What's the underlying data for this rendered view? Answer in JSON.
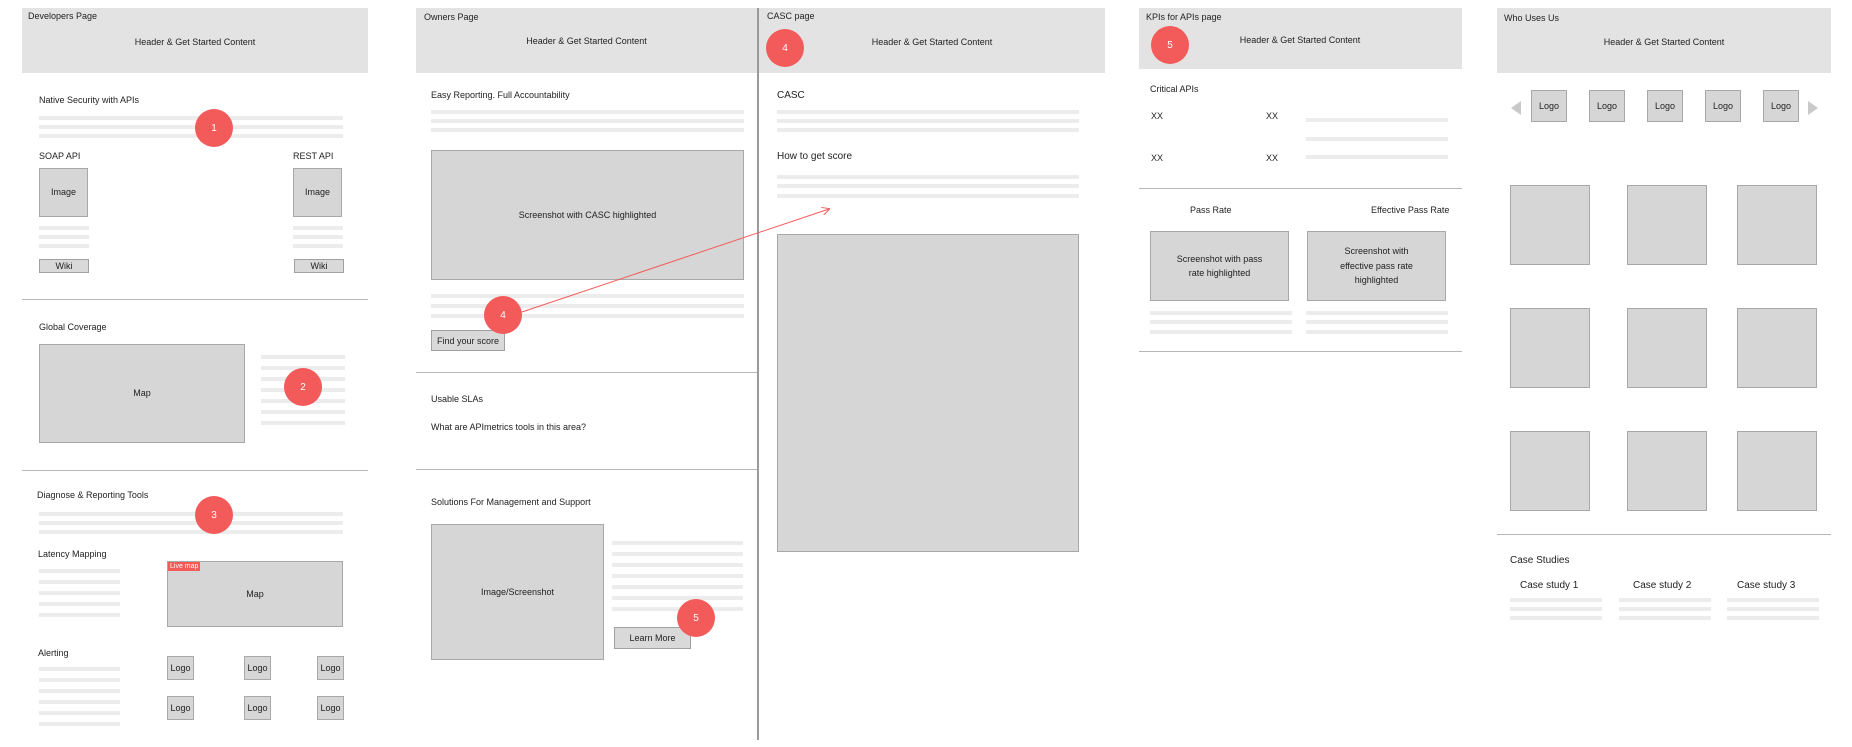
{
  "colors": {
    "header_bg": "#e4e3e4",
    "placeholder_bg": "#d6d6d6",
    "marker": "#f35a5a",
    "line": "#ececec",
    "rule": "#b7b7b7"
  },
  "common": {
    "header_content": "Header & Get Started Content"
  },
  "dev": {
    "title": "Developers Page",
    "native_security": "Native Security with APIs",
    "soap_api": "SOAP API",
    "rest_api": "REST API",
    "image": "Image",
    "wiki": "Wiki",
    "global_coverage": "Global Coverage",
    "map": "Map",
    "diagnose": "Diagnose & Reporting Tools",
    "latency_mapping": "Latency Mapping",
    "live_map": "Live map",
    "alerting": "Alerting",
    "logo": "Logo"
  },
  "owners": {
    "title": "Owners Page",
    "easy_reporting": "Easy Reporting. Full Accountability",
    "screenshot_casc": "Screenshot with CASC highlighted",
    "find_score": "Find your score",
    "usable_slas": "Usable SLAs",
    "tools_question": "What are APImetrics tools in this area?",
    "solutions": "Solutions For Management and Support",
    "image_screenshot": "Image/Screenshot",
    "learn_more": "Learn More"
  },
  "casc": {
    "title": "CASC page",
    "casc": "CASC",
    "how_to": "How to get score"
  },
  "kpi": {
    "title": "KPIs for APIs page",
    "critical_apis": "Critical APIs",
    "xx": "XX",
    "pass_rate": "Pass Rate",
    "effective_pass_rate": "Effective Pass Rate",
    "screenshot_pass": "Screenshot with pass rate highlighted",
    "screenshot_effective": "Screenshot with effective pass rate highlighted"
  },
  "who": {
    "title": "Who Uses Us",
    "logo": "Logo",
    "case_studies": "Case Studies",
    "case_study_1": "Case study 1",
    "case_study_2": "Case study 2",
    "case_study_3": "Case study 3"
  },
  "markers": {
    "m1": "1",
    "m2": "2",
    "m3": "3",
    "m4": "4",
    "m5": "5"
  }
}
